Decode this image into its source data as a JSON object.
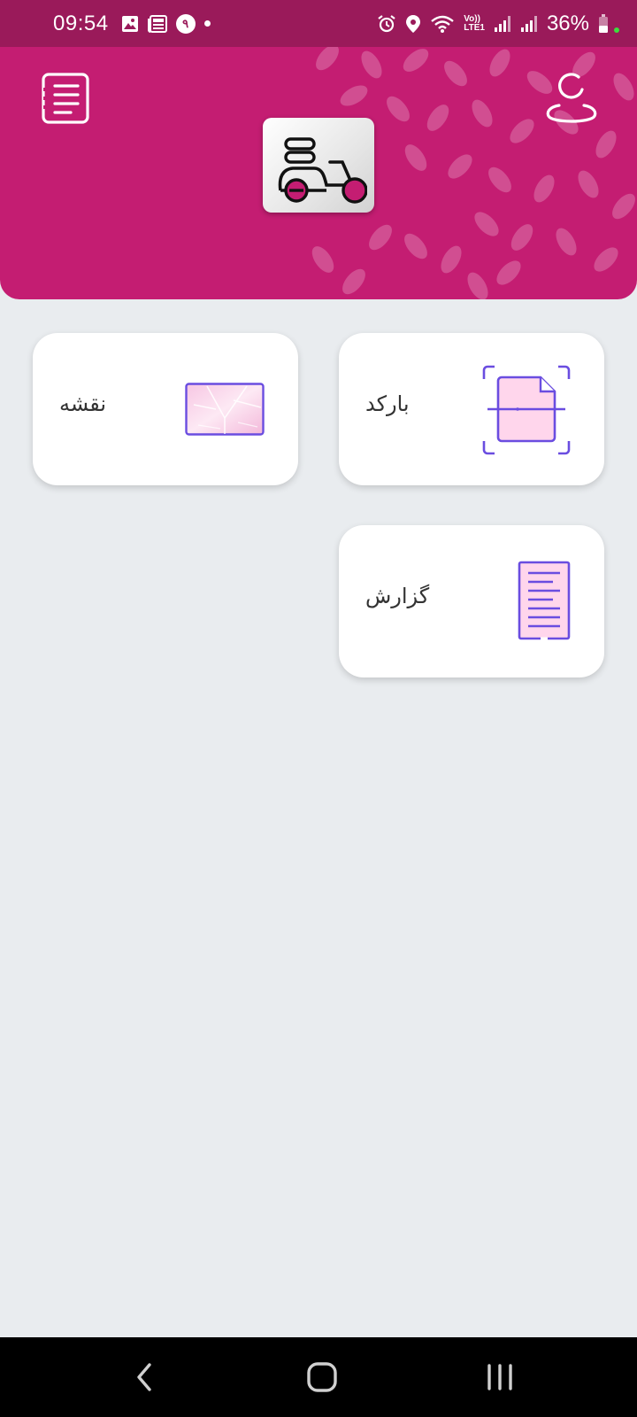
{
  "status_bar": {
    "time": "09:54",
    "notification_badge": "۹",
    "network_label_top": "Vo))",
    "network_label_bottom": "LTE1",
    "battery_percent": "36%",
    "icons": [
      "gallery-icon",
      "news-icon",
      "alarm-icon",
      "location-icon",
      "wifi-icon",
      "signal-icon",
      "battery-icon"
    ]
  },
  "header": {
    "background_color": "#c41d72",
    "menu_icon": "list-icon",
    "profile_icon": "user-icon",
    "logo_icon": "delivery-scooter-icon"
  },
  "cards": [
    {
      "label": "بارکد",
      "icon": "barcode-scan-icon"
    },
    {
      "label": "نقشه",
      "icon": "map-icon"
    },
    {
      "label": "گزارش",
      "icon": "report-icon"
    }
  ],
  "nav_bar": {
    "buttons": [
      "back-icon",
      "home-icon",
      "recents-icon"
    ]
  }
}
